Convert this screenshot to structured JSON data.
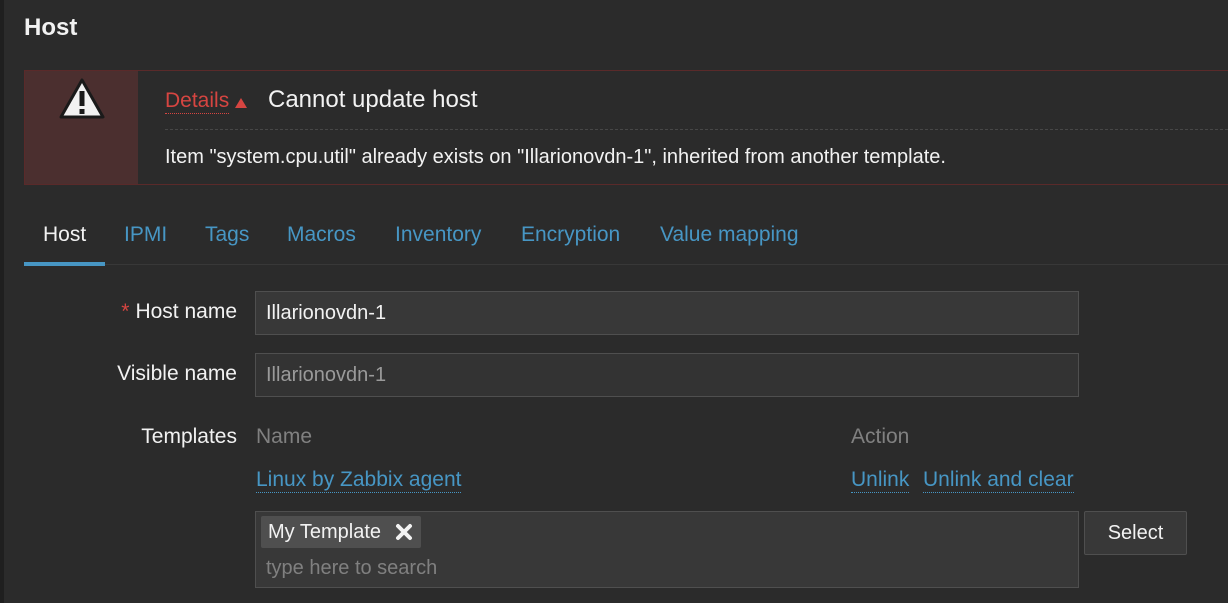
{
  "page": {
    "title": "Host"
  },
  "message": {
    "details_label": "Details",
    "title": "Cannot update host",
    "detail": "Item \"system.cpu.util\" already exists on \"Illarionovdn-1\", inherited from another template."
  },
  "tabs": [
    {
      "label": "Host",
      "active": true
    },
    {
      "label": "IPMI"
    },
    {
      "label": "Tags"
    },
    {
      "label": "Macros"
    },
    {
      "label": "Inventory"
    },
    {
      "label": "Encryption"
    },
    {
      "label": "Value mapping"
    }
  ],
  "form": {
    "host_name": {
      "required_mark": "*",
      "label": "Host name",
      "value": "Illarionovdn-1"
    },
    "visible_name": {
      "label": "Visible name",
      "placeholder": "Illarionovdn-1"
    },
    "templates": {
      "label": "Templates",
      "col_name": "Name",
      "col_action": "Action",
      "linked": [
        {
          "name": "Linux by Zabbix agent",
          "unlink": "Unlink",
          "unlink_clear": "Unlink and clear"
        }
      ],
      "selected_chip": "My Template",
      "search_placeholder": "type here to search",
      "select_button": "Select"
    }
  },
  "colors": {
    "link": "#4796c4",
    "error": "#d64541",
    "background": "#2b2b2b"
  }
}
